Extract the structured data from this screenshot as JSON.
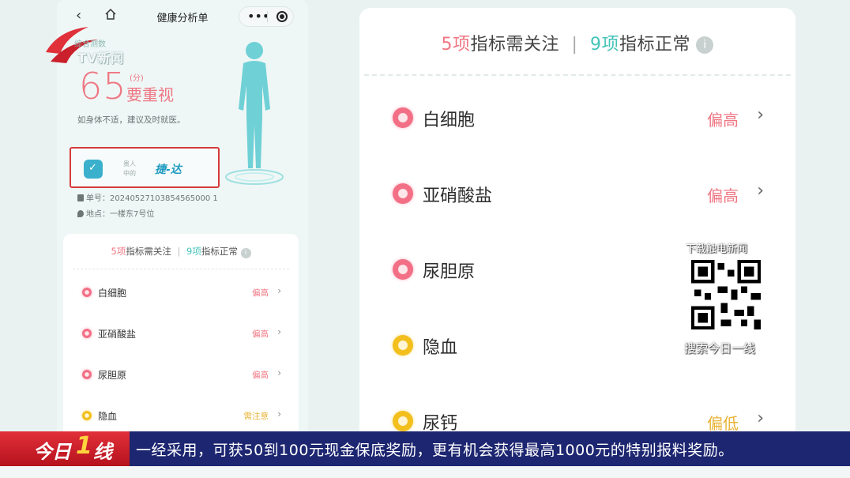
{
  "window": {
    "title": "健康分析单"
  },
  "overlay": {
    "logo_caption": "综合测数",
    "logo_news": "TV新闻"
  },
  "report": {
    "score": "65",
    "score_unit": "(分)",
    "level": "要重视",
    "advice": "如身体不适，建议及时就医。",
    "hospital_small_1": "贵人",
    "hospital_small_2": "中的",
    "hospital_brand": "捷-达",
    "order_no": "单号：20240527103854565000 1",
    "location": "地点：一楼东7号位"
  },
  "summary": {
    "attention_count": "5项",
    "attention_text": "指标需关注",
    "separator": "|",
    "normal_count": "9项",
    "normal_text": "指标正常",
    "info_icon": "i"
  },
  "indicators_small": [
    {
      "name": "白细胞",
      "status": "偏高",
      "color": "#ef7683"
    },
    {
      "name": "亚硝酸盐",
      "status": "偏高",
      "color": "#ef7683"
    },
    {
      "name": "尿胆原",
      "status": "偏高",
      "color": "#ef7683"
    },
    {
      "name": "隐血",
      "status": "需注意",
      "color": "#e8b336"
    }
  ],
  "indicators_zoom": [
    {
      "name": "白细胞",
      "status": "偏高",
      "color": "#ef7683"
    },
    {
      "name": "亚硝酸盐",
      "status": "偏高",
      "color": "#ef7683"
    },
    {
      "name": "尿胆原",
      "status": "",
      "color": "#ef7683"
    },
    {
      "name": "隐血",
      "status": "",
      "color": "#e8b336"
    },
    {
      "name": "尿钙",
      "status": "偏低",
      "color": "#e8b336"
    }
  ],
  "qr": {
    "caption_top": "下载触电新闻",
    "caption_bottom": "搜索今日一线"
  },
  "ticker": {
    "logo_a": "今日",
    "logo_b": "1",
    "logo_c": "线",
    "text": "一经采用，可获50到100元现金保底奖励，更有机会获得最高1000元的特别报料奖励。"
  }
}
